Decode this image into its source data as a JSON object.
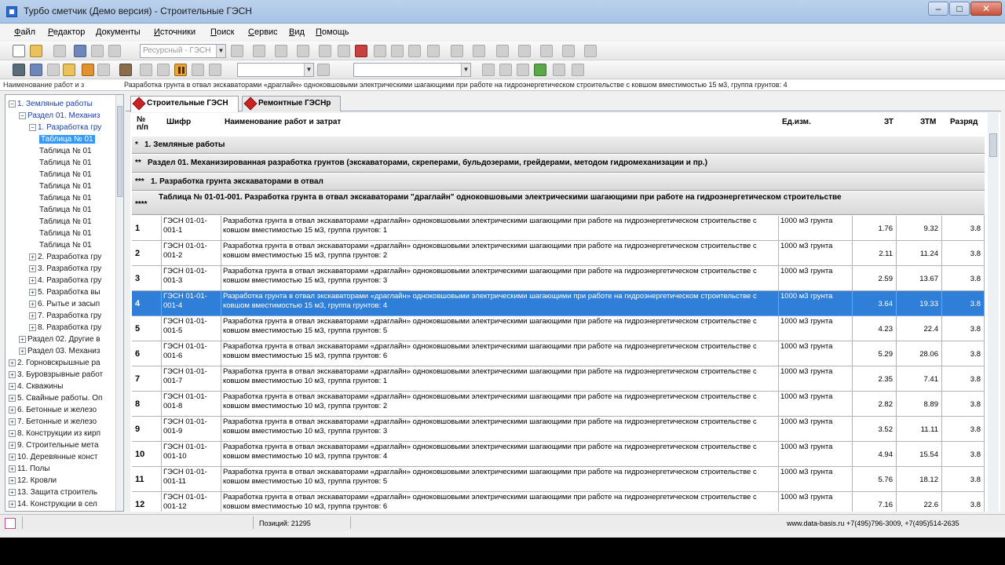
{
  "window": {
    "title": "Турбо сметчик (Демо версия) - Строительные ГЭСН"
  },
  "menu": [
    "Файл",
    "Редактор",
    "Документы",
    "Источники",
    "Поиск",
    "Сервис",
    "Вид",
    "Помощь"
  ],
  "toolbar2": {
    "resource_combo": "Ресурсный - ГЭСН"
  },
  "infoline": {
    "label": "Наименование работ и з",
    "text": "Разработка грунта в отвал экскаваторами «драглайн» одноковшовыми электрическими шагающими при работе на гидроэнергетическом строительстве с ковшом вместимостью 15 м3, группа грунтов: 4"
  },
  "tree": [
    {
      "label": "1. Земляные работы",
      "expander": "−",
      "level": 0,
      "style": "blue"
    },
    {
      "label": "Раздел 01. Механиз",
      "expander": "−",
      "level": 1,
      "style": "blue"
    },
    {
      "label": "1. Разработка гру",
      "expander": "−",
      "level": 2,
      "style": "blue"
    },
    {
      "label": "Таблица № 01",
      "expander": "",
      "level": 3,
      "style": "sel"
    },
    {
      "label": "Таблица № 01",
      "expander": "",
      "level": 3,
      "style": ""
    },
    {
      "label": "Таблица № 01",
      "expander": "",
      "level": 3,
      "style": ""
    },
    {
      "label": "Таблица № 01",
      "expander": "",
      "level": 3,
      "style": ""
    },
    {
      "label": "Таблица № 01",
      "expander": "",
      "level": 3,
      "style": ""
    },
    {
      "label": "Таблица № 01",
      "expander": "",
      "level": 3,
      "style": ""
    },
    {
      "label": "Таблица № 01",
      "expander": "",
      "level": 3,
      "style": ""
    },
    {
      "label": "Таблица № 01",
      "expander": "",
      "level": 3,
      "style": ""
    },
    {
      "label": "Таблица № 01",
      "expander": "",
      "level": 3,
      "style": ""
    },
    {
      "label": "Таблица № 01",
      "expander": "",
      "level": 3,
      "style": ""
    },
    {
      "label": "2. Разработка гру",
      "expander": "+",
      "level": 2,
      "style": ""
    },
    {
      "label": "3. Разработка гру",
      "expander": "+",
      "level": 2,
      "style": ""
    },
    {
      "label": "4. Разработка гру",
      "expander": "+",
      "level": 2,
      "style": ""
    },
    {
      "label": "5. Разработка вы",
      "expander": "+",
      "level": 2,
      "style": ""
    },
    {
      "label": "6. Рытье и засып",
      "expander": "+",
      "level": 2,
      "style": ""
    },
    {
      "label": "7. Разработка гру",
      "expander": "+",
      "level": 2,
      "style": ""
    },
    {
      "label": "8. Разработка гру",
      "expander": "+",
      "level": 2,
      "style": ""
    },
    {
      "label": "Раздел 02. Другие в",
      "expander": "+",
      "level": 1,
      "style": ""
    },
    {
      "label": "Раздел 03. Механиз",
      "expander": "+",
      "level": 1,
      "style": ""
    },
    {
      "label": "2. Горновскрышные ра",
      "expander": "+",
      "level": 0,
      "style": ""
    },
    {
      "label": "3. Буровзрывные работ",
      "expander": "+",
      "level": 0,
      "style": ""
    },
    {
      "label": "4. Скважины",
      "expander": "+",
      "level": 0,
      "style": ""
    },
    {
      "label": "5. Свайные работы. Оп",
      "expander": "+",
      "level": 0,
      "style": ""
    },
    {
      "label": "6. Бетонные и железо",
      "expander": "+",
      "level": 0,
      "style": ""
    },
    {
      "label": "7. Бетонные и железо",
      "expander": "+",
      "level": 0,
      "style": ""
    },
    {
      "label": "8. Конструкции из кирп",
      "expander": "+",
      "level": 0,
      "style": ""
    },
    {
      "label": "9. Строительные мета",
      "expander": "+",
      "level": 0,
      "style": ""
    },
    {
      "label": "10. Деревянные конст",
      "expander": "+",
      "level": 0,
      "style": ""
    },
    {
      "label": "11. Полы",
      "expander": "+",
      "level": 0,
      "style": ""
    },
    {
      "label": "12. Кровли",
      "expander": "+",
      "level": 0,
      "style": ""
    },
    {
      "label": "13. Защита строитель",
      "expander": "+",
      "level": 0,
      "style": ""
    },
    {
      "label": "14. Конструкции в сел",
      "expander": "+",
      "level": 0,
      "style": ""
    }
  ],
  "tabs": [
    {
      "label": "Строительные ГЭСН",
      "active": true
    },
    {
      "label": "Ремонтные ГЭСНр",
      "active": false
    }
  ],
  "grid": {
    "headers": {
      "num": "№ п/п",
      "code": "Шифр",
      "name": "Наименование работ и затрат",
      "unit": "Ед.изм.",
      "zt": "ЗТ",
      "ztm": "ЗТМ",
      "razr": "Разряд"
    },
    "groups": [
      {
        "stars": "*",
        "text": "1. Земляные работы"
      },
      {
        "stars": "**",
        "text": "Раздел 01. Механизированная разработка грунтов (экскаваторами, скреперами, бульдозерами, грейдерами, методом гидромеханизации и пр.)"
      },
      {
        "stars": "***",
        "text": "1. Разработка грунта экскаваторами в отвал"
      },
      {
        "stars": "****",
        "text": "Таблица № 01-01-001. Разработка грунта в отвал экскаваторами \"драглайн\" одноковшовыми электрическими шагающими при работе на гидроэнергетическом строительстве"
      }
    ],
    "rows": [
      {
        "num": "1",
        "code": "ГЭСН 01-01-001-1",
        "name": "Разработка грунта в отвал экскаваторами «драглайн» одноковшовыми электрическими шагающими при работе на гидроэнергетическом строительстве с ковшом вместимостью 15 м3, группа грунтов: 1",
        "unit": "1000 м3 грунта",
        "zt": "1.76",
        "ztm": "9.32",
        "razr": "3.8",
        "selected": false
      },
      {
        "num": "2",
        "code": "ГЭСН 01-01-001-2",
        "name": "Разработка грунта в отвал экскаваторами «драглайн» одноковшовыми электрическими шагающими при работе на гидроэнергетическом строительстве с ковшом вместимостью 15 м3, группа грунтов: 2",
        "unit": "1000 м3 грунта",
        "zt": "2.11",
        "ztm": "11.24",
        "razr": "3.8",
        "selected": false
      },
      {
        "num": "3",
        "code": "ГЭСН 01-01-001-3",
        "name": "Разработка грунта в отвал экскаваторами «драглайн» одноковшовыми электрическими шагающими при работе на гидроэнергетическом строительстве с ковшом вместимостью 15 м3, группа грунтов: 3",
        "unit": "1000 м3 грунта",
        "zt": "2.59",
        "ztm": "13.67",
        "razr": "3.8",
        "selected": false
      },
      {
        "num": "4",
        "code": "ГЭСН 01-01-001-4",
        "name": "Разработка грунта в отвал экскаваторами «драглайн» одноковшовыми электрическими шагающими при работе на гидроэнергетическом строительстве с ковшом вместимостью 15 м3, группа грунтов: 4",
        "unit": "1000 м3 грунта",
        "zt": "3.64",
        "ztm": "19.33",
        "razr": "3.8",
        "selected": true
      },
      {
        "num": "5",
        "code": "ГЭСН 01-01-001-5",
        "name": "Разработка грунта в отвал экскаваторами «драглайн» одноковшовыми электрическими шагающими при работе на гидроэнергетическом строительстве с ковшом вместимостью 15 м3, группа грунтов: 5",
        "unit": "1000 м3 грунта",
        "zt": "4.23",
        "ztm": "22.4",
        "razr": "3.8",
        "selected": false
      },
      {
        "num": "6",
        "code": "ГЭСН 01-01-001-6",
        "name": "Разработка грунта в отвал экскаваторами «драглайн» одноковшовыми электрическими шагающими при работе на гидроэнергетическом строительстве с ковшом вместимостью 15 м3, группа грунтов: 6",
        "unit": "1000 м3 грунта",
        "zt": "5.29",
        "ztm": "28.06",
        "razr": "3.8",
        "selected": false
      },
      {
        "num": "7",
        "code": "ГЭСН 01-01-001-7",
        "name": "Разработка грунта в отвал экскаваторами «драглайн» одноковшовыми электрическими шагающими при работе на гидроэнергетическом строительстве с ковшом вместимостью 10 м3, группа грунтов: 1",
        "unit": "1000 м3 грунта",
        "zt": "2.35",
        "ztm": "7.41",
        "razr": "3.8",
        "selected": false
      },
      {
        "num": "8",
        "code": "ГЭСН 01-01-001-8",
        "name": "Разработка грунта в отвал экскаваторами «драглайн» одноковшовыми электрическими шагающими при работе на гидроэнергетическом строительстве с ковшом вместимостью 10 м3, группа грунтов: 2",
        "unit": "1000 м3 грунта",
        "zt": "2.82",
        "ztm": "8.89",
        "razr": "3.8",
        "selected": false
      },
      {
        "num": "9",
        "code": "ГЭСН 01-01-001-9",
        "name": "Разработка грунта в отвал экскаваторами «драглайн» одноковшовыми электрическими шагающими при работе на гидроэнергетическом строительстве с ковшом вместимостью 10 м3, группа грунтов: 3",
        "unit": "1000 м3 грунта",
        "zt": "3.52",
        "ztm": "11.11",
        "razr": "3.8",
        "selected": false
      },
      {
        "num": "10",
        "code": "ГЭСН 01-01-001-10",
        "name": "Разработка грунта в отвал экскаваторами «драглайн» одноковшовыми электрическими шагающими при работе на гидроэнергетическом строительстве с ковшом вместимостью 10 м3, группа грунтов: 4",
        "unit": "1000 м3 грунта",
        "zt": "4.94",
        "ztm": "15.54",
        "razr": "3.8",
        "selected": false
      },
      {
        "num": "11",
        "code": "ГЭСН 01-01-001-11",
        "name": "Разработка грунта в отвал экскаваторами «драглайн» одноковшовыми электрическими шагающими при работе на гидроэнергетическом строительстве с ковшом вместимостью 10 м3, группа грунтов: 5",
        "unit": "1000 м3 грунта",
        "zt": "5.76",
        "ztm": "18.12",
        "razr": "3.8",
        "selected": false
      },
      {
        "num": "12",
        "code": "ГЭСН 01-01-001-12",
        "name": "Разработка грунта в отвал экскаваторами «драглайн» одноковшовыми электрическими шагающими при работе на гидроэнергетическом строительстве с ковшом вместимостью 10 м3, группа грунтов: 6",
        "unit": "1000 м3 грунта",
        "zt": "7.16",
        "ztm": "22.6",
        "razr": "3.8",
        "selected": false
      }
    ]
  },
  "status": {
    "position": "Позиций: 21295",
    "contacts": "www.data-basis.ru   +7(495)796-3009, +7(495)514-2635"
  }
}
